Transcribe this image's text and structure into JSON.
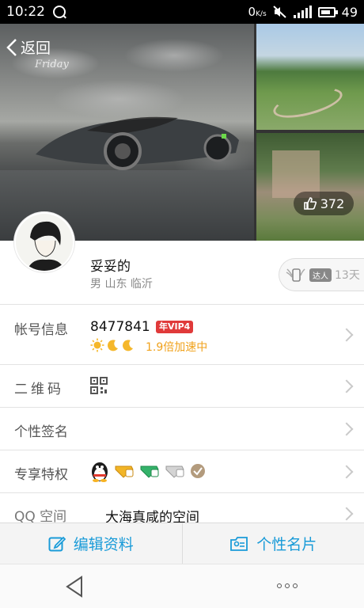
{
  "status_bar": {
    "time": "10:22",
    "speed": "0",
    "speed_unit": "K/s",
    "battery": "49"
  },
  "header": {
    "back_label": "返回",
    "photo_caption": "Friday",
    "likes": "372"
  },
  "profile": {
    "nickname": "妥妥的",
    "location": "男 山东 临沂",
    "expert_tag": "达人",
    "expert_days": "13天"
  },
  "rows": {
    "account": {
      "label": "帐号信息",
      "qq_number": "8477841",
      "vip_badge": "年VIP4",
      "speedup": "1.9倍加速中"
    },
    "qrcode": {
      "label": "二维码"
    },
    "signature": {
      "label": "个性签名"
    },
    "privilege": {
      "label": "专享特权"
    },
    "zone": {
      "label": "QQ 空间",
      "name": "大海真咸的空间"
    }
  },
  "actions": {
    "edit_profile": "编辑资料",
    "profile_card": "个性名片"
  },
  "colors": {
    "accent": "#1a9bd8",
    "vip_red": "#e03a3a",
    "speedup_orange": "#f0a21c"
  },
  "icons": [
    "q-icon",
    "mute-icon",
    "signal-icon",
    "battery-icon",
    "back-chevron-icon",
    "thumbs-up-icon",
    "phone-wings-icon",
    "sun-icon",
    "moon-icon",
    "qr-code-icon",
    "qq-penguin-icon",
    "edit-icon",
    "card-icon",
    "nav-back-icon",
    "more-icon"
  ]
}
